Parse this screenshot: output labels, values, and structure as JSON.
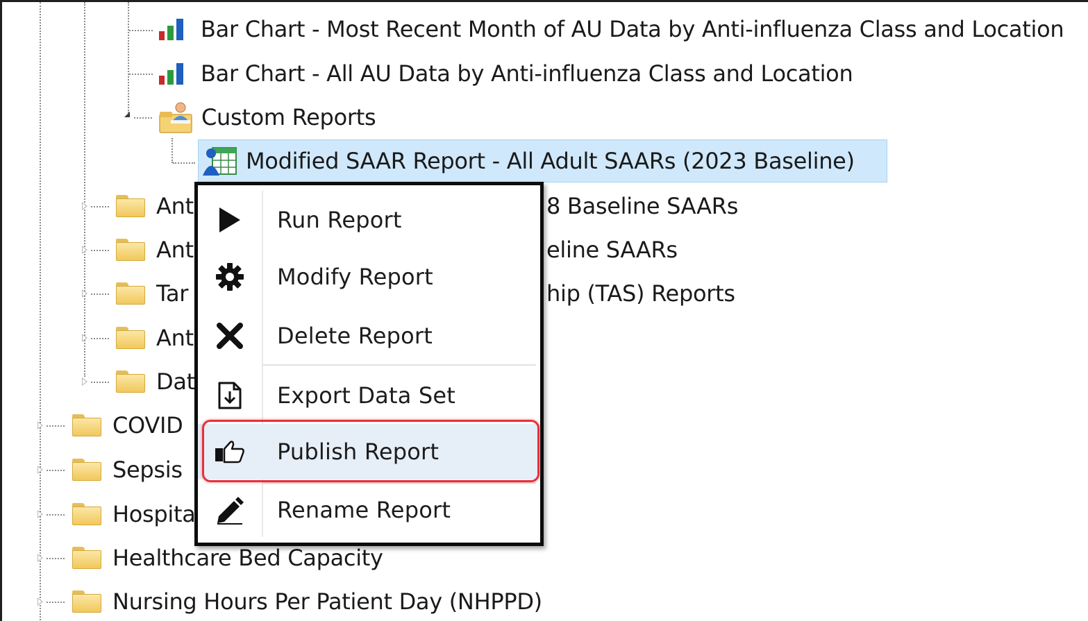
{
  "tree": {
    "nodes": {
      "bar_chart_recent": "Bar Chart - Most Recent Month of AU Data by Anti-influenza Class and Location",
      "bar_chart_all": "Bar Chart - All AU Data by Anti-influenza Class and Location",
      "custom_reports": "Custom Reports",
      "modified_saar": "Modified SAAR Report - All Adult SAARs (2023 Baseline)",
      "ant1_visible": "Ant",
      "ant1_tail": "8 Baseline SAARs",
      "ant2_visible": "Ant",
      "ant2_tail": "eline SAARs",
      "tar_visible": "Tar",
      "tar_tail": "hip (TAS) Reports",
      "ant3_visible": "Ant",
      "dat_visible": "Dat",
      "covid_visible": "COVID",
      "sepsis": "Sepsis",
      "hospital_visible": "Hospita",
      "bed_capacity": "Healthcare Bed Capacity",
      "nhppd": "Nursing Hours Per Patient Day (NHPPD)"
    }
  },
  "context_menu": {
    "run": "Run Report",
    "modify": "Modify Report",
    "delete": "Delete Report",
    "export": "Export Data Set",
    "publish": "Publish Report",
    "rename": "Rename Report",
    "highlighted_item": "publish"
  },
  "icons": {
    "folder": "folder-icon",
    "bar_chart": "bar-chart-icon",
    "custom_reports": "custom-reports-icon",
    "report": "report-icon",
    "run": "play-icon",
    "modify": "gear-icon",
    "delete": "x-icon",
    "export": "export-document-icon",
    "publish": "thumbs-up-icon",
    "rename": "pencil-icon"
  },
  "colors": {
    "selection_bg": "#cfe8fb",
    "highlight_ring": "#e8303a",
    "menu_border": "#0c0c0c"
  }
}
